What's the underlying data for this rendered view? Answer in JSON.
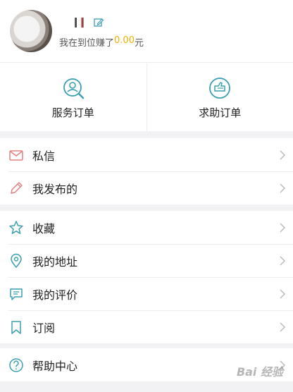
{
  "profile": {
    "earn_prefix": "我在到位赚了",
    "earn_amount": "0.00",
    "earn_suffix": "元"
  },
  "orders": [
    {
      "label": "服务订单",
      "icon": "search-person-icon"
    },
    {
      "label": "求助订单",
      "icon": "hand-help-icon"
    }
  ],
  "menu_groups": [
    [
      {
        "label": "私信",
        "icon": "mail-icon"
      },
      {
        "label": "我发布的",
        "icon": "pencil-icon"
      }
    ],
    [
      {
        "label": "收藏",
        "icon": "star-icon"
      },
      {
        "label": "我的地址",
        "icon": "location-pin-icon"
      },
      {
        "label": "我的评价",
        "icon": "comment-icon"
      },
      {
        "label": "订阅",
        "icon": "bookmark-icon"
      }
    ],
    [
      {
        "label": "帮助中心",
        "icon": "help-icon"
      }
    ]
  ],
  "colors": {
    "accent": "#3a9fb0",
    "mail": "#e08080",
    "amount": "#f0b000"
  },
  "watermark": "Bai 经验"
}
